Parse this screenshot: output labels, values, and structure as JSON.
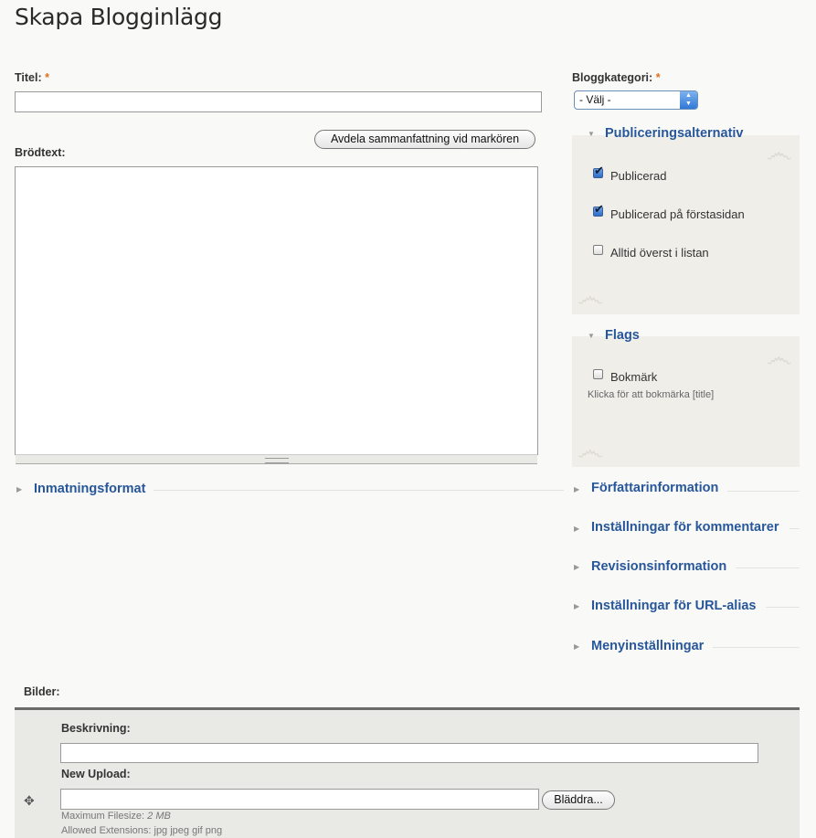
{
  "page": {
    "title": "Skapa Blogginlägg"
  },
  "form": {
    "title_label": "Titel:",
    "required_mark": "*",
    "title_value": "",
    "summary_button": "Avdela sammanfattning vid markören",
    "body_label": "Brödtext:",
    "body_value": "",
    "input_format": "Inmatningsformat"
  },
  "sidebar": {
    "category_label": "Bloggkategori:",
    "category_selected": "- Välj -",
    "publishing": {
      "title": "Publiceringsalternativ",
      "options": [
        {
          "label": "Publicerad",
          "checked": true
        },
        {
          "label": "Publicerad på förstasidan",
          "checked": true
        },
        {
          "label": "Alltid överst i listan",
          "checked": false
        }
      ]
    },
    "flags": {
      "title": "Flags",
      "option_label": "Bokmärk",
      "option_checked": false,
      "description": "Klicka för att bokmärka [title]"
    },
    "collapsed_sections": [
      "Författarinformation",
      "Inställningar för kommentarer",
      "Revisionsinformation",
      "Inställningar för URL-alias",
      "Menyinställningar"
    ]
  },
  "images": {
    "label": "Bilder:",
    "description_label": "Beskrivning:",
    "description_value": "",
    "upload_label": "New Upload:",
    "browse_button": "Bläddra...",
    "max_filesize_label": "Maximum Filesize:",
    "max_filesize_value": "2 MB",
    "allowed_extensions_text": "Allowed Extensions: jpg jpeg gif png"
  },
  "icons": {
    "collapsed": "triangle-right-icon",
    "expanded": "triangle-down-icon",
    "drag": "drag-handle-icon"
  },
  "colors": {
    "section_link": "#27579a",
    "required": "#e07020"
  }
}
